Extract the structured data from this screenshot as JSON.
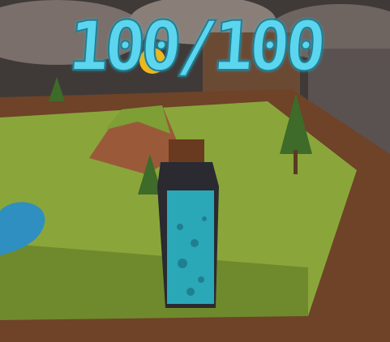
{
  "hud": {
    "health_text": "100/100"
  },
  "colors": {
    "text": "#5cd6ee",
    "terrain": "#8aa63a",
    "table": "#7a4a2c",
    "potion": "#2aa8b8"
  }
}
